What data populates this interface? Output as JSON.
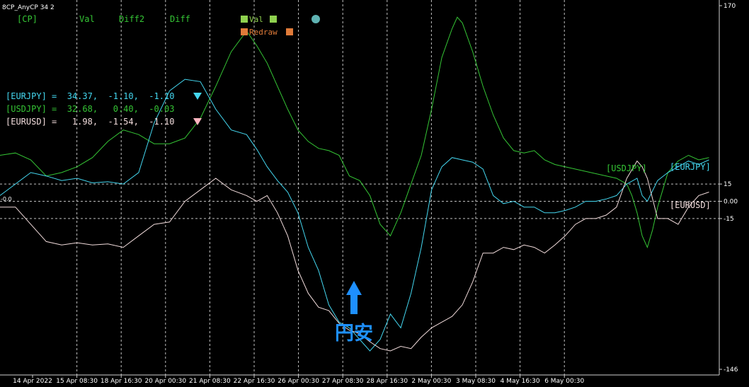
{
  "indicator_title": "8CP_AnyCP 34 2",
  "header_labels": [
    {
      "id": "cp",
      "text": "[CP]",
      "color": "#35c535"
    },
    {
      "id": "val",
      "text": "Val",
      "color": "#35c535"
    },
    {
      "id": "diff2",
      "text": "Diff2",
      "color": "#35c535"
    },
    {
      "id": "diff",
      "text": "Diff",
      "color": "#35c535"
    }
  ],
  "toggles": [
    {
      "id": "val",
      "text": "Val",
      "color": "#8fd14f",
      "box_color": "#8fd14f"
    },
    {
      "id": "redraw",
      "text": "Redraw",
      "color": "#e07b39",
      "box_color": "#e07b39"
    }
  ],
  "dot_color": "#5fb3b3",
  "readouts": [
    {
      "pair": "[EURJPY]",
      "text": "[EURJPY] =  34.37,  -1.10,  -1.10",
      "color": "#44d7f0",
      "marker": "down-triangle",
      "marker_color": "#44d7f0"
    },
    {
      "pair": "[USDJPY]",
      "text": "[USDJPY] =  32.68,   0.40,  -0.03",
      "color": "#35c535"
    },
    {
      "pair": "[EURUSD]",
      "text": "[EURUSD] =   1.98,  -1.54,  -1.10",
      "color": "#f2dcdc",
      "marker": "down-triangle",
      "marker_color": "#ffb6c1"
    }
  ],
  "line_labels": [
    {
      "text": "[USDJPY]",
      "color": "#35c535"
    },
    {
      "text": "[EURJPY]",
      "color": "#44d7f0"
    },
    {
      "text": "[EURUSD]",
      "color": "#f2dcdc"
    }
  ],
  "left_edge_label": "-0.0",
  "annotation": {
    "arrow": "up-arrow",
    "text": "円安",
    "color": "#1e90ff"
  },
  "chart_data": {
    "type": "line",
    "ylim": [
      -146,
      170
    ],
    "y_ticks": [
      "170",
      "15",
      "0.00",
      "-15",
      "-146"
    ],
    "levels": [
      15,
      0,
      -15
    ],
    "x_tick_labels": [
      "14 Apr 2022",
      "15 Apr 08:30",
      "18 Apr 16:30",
      "20 Apr 00:30",
      "21 Apr 08:30",
      "22 Apr 16:30",
      "26 Apr 00:30",
      "27 Apr 08:30",
      "28 Apr 16:30",
      "2 May 00:30",
      "3 May 08:30",
      "4 May 16:30",
      "6 May 00:30"
    ],
    "grid": "vertical dashed at each date label; horizontal dashed at 15, 0, -15",
    "series": [
      {
        "name": "[USDJPY]",
        "color": "#35c535",
        "points": [
          [
            0,
            40
          ],
          [
            3,
            42
          ],
          [
            6,
            36
          ],
          [
            9,
            22
          ],
          [
            12,
            25
          ],
          [
            15,
            30
          ],
          [
            18,
            38
          ],
          [
            21,
            52
          ],
          [
            24,
            62
          ],
          [
            27,
            58
          ],
          [
            30,
            50
          ],
          [
            33,
            50
          ],
          [
            36,
            55
          ],
          [
            39,
            72
          ],
          [
            42,
            100
          ],
          [
            45,
            130
          ],
          [
            48,
            148
          ],
          [
            50,
            135
          ],
          [
            52,
            120
          ],
          [
            54,
            100
          ],
          [
            56,
            80
          ],
          [
            58,
            62
          ],
          [
            60,
            52
          ],
          [
            62,
            46
          ],
          [
            64,
            44
          ],
          [
            66,
            40
          ],
          [
            68,
            22
          ],
          [
            70,
            18
          ],
          [
            72,
            5
          ],
          [
            74,
            -20
          ],
          [
            76,
            -30
          ],
          [
            78,
            -10
          ],
          [
            80,
            15
          ],
          [
            82,
            40
          ],
          [
            84,
            80
          ],
          [
            86,
            125
          ],
          [
            88,
            150
          ],
          [
            89,
            160
          ],
          [
            90,
            155
          ],
          [
            92,
            130
          ],
          [
            94,
            100
          ],
          [
            96,
            75
          ],
          [
            98,
            55
          ],
          [
            100,
            44
          ],
          [
            102,
            42
          ],
          [
            104,
            44
          ],
          [
            106,
            36
          ],
          [
            108,
            32
          ],
          [
            110,
            30
          ],
          [
            112,
            28
          ],
          [
            114,
            26
          ],
          [
            116,
            24
          ],
          [
            118,
            22
          ],
          [
            120,
            20
          ],
          [
            122,
            15
          ],
          [
            123,
            5
          ],
          [
            124,
            -10
          ],
          [
            125,
            -30
          ],
          [
            126,
            -40
          ],
          [
            127,
            -25
          ],
          [
            128,
            -5
          ],
          [
            129,
            10
          ],
          [
            130,
            25
          ],
          [
            132,
            35
          ],
          [
            134,
            40
          ],
          [
            136,
            36
          ],
          [
            138,
            38
          ]
        ]
      },
      {
        "name": "[EURJPY]",
        "color": "#44d7f0",
        "points": [
          [
            0,
            5
          ],
          [
            3,
            15
          ],
          [
            6,
            25
          ],
          [
            9,
            22
          ],
          [
            12,
            18
          ],
          [
            15,
            20
          ],
          [
            18,
            16
          ],
          [
            21,
            17
          ],
          [
            24,
            15
          ],
          [
            27,
            25
          ],
          [
            30,
            68
          ],
          [
            33,
            96
          ],
          [
            36,
            106
          ],
          [
            39,
            104
          ],
          [
            42,
            80
          ],
          [
            45,
            62
          ],
          [
            48,
            58
          ],
          [
            50,
            45
          ],
          [
            52,
            30
          ],
          [
            54,
            18
          ],
          [
            56,
            8
          ],
          [
            58,
            -10
          ],
          [
            60,
            -40
          ],
          [
            62,
            -60
          ],
          [
            64,
            -90
          ],
          [
            66,
            -105
          ],
          [
            68,
            -110
          ],
          [
            70,
            -120
          ],
          [
            72,
            -130
          ],
          [
            74,
            -120
          ],
          [
            76,
            -98
          ],
          [
            78,
            -110
          ],
          [
            80,
            -80
          ],
          [
            82,
            -40
          ],
          [
            84,
            10
          ],
          [
            86,
            30
          ],
          [
            88,
            38
          ],
          [
            90,
            36
          ],
          [
            92,
            34
          ],
          [
            94,
            28
          ],
          [
            96,
            5
          ],
          [
            98,
            -2
          ],
          [
            100,
            0
          ],
          [
            102,
            -5
          ],
          [
            104,
            -5
          ],
          [
            106,
            -10
          ],
          [
            108,
            -10
          ],
          [
            110,
            -8
          ],
          [
            112,
            -5
          ],
          [
            114,
            0
          ],
          [
            116,
            0
          ],
          [
            118,
            2
          ],
          [
            120,
            5
          ],
          [
            122,
            15
          ],
          [
            124,
            20
          ],
          [
            125,
            5
          ],
          [
            126,
            0
          ],
          [
            128,
            18
          ],
          [
            130,
            25
          ],
          [
            132,
            30
          ],
          [
            134,
            35
          ],
          [
            136,
            32
          ],
          [
            138,
            36
          ]
        ]
      },
      {
        "name": "[EURUSD]",
        "color": "#f2dcdc",
        "points": [
          [
            0,
            -5
          ],
          [
            3,
            -5
          ],
          [
            6,
            -20
          ],
          [
            9,
            -35
          ],
          [
            12,
            -38
          ],
          [
            15,
            -36
          ],
          [
            18,
            -38
          ],
          [
            21,
            -37
          ],
          [
            24,
            -40
          ],
          [
            27,
            -30
          ],
          [
            30,
            -20
          ],
          [
            33,
            -18
          ],
          [
            36,
            0
          ],
          [
            39,
            10
          ],
          [
            42,
            20
          ],
          [
            45,
            10
          ],
          [
            48,
            5
          ],
          [
            50,
            0
          ],
          [
            52,
            5
          ],
          [
            54,
            -10
          ],
          [
            56,
            -30
          ],
          [
            58,
            -60
          ],
          [
            60,
            -80
          ],
          [
            62,
            -92
          ],
          [
            64,
            -95
          ],
          [
            66,
            -106
          ],
          [
            68,
            -112
          ],
          [
            70,
            -115
          ],
          [
            72,
            -122
          ],
          [
            74,
            -128
          ],
          [
            76,
            -130
          ],
          [
            78,
            -126
          ],
          [
            80,
            -128
          ],
          [
            82,
            -118
          ],
          [
            84,
            -110
          ],
          [
            86,
            -105
          ],
          [
            88,
            -100
          ],
          [
            90,
            -90
          ],
          [
            92,
            -70
          ],
          [
            94,
            -45
          ],
          [
            96,
            -45
          ],
          [
            98,
            -40
          ],
          [
            100,
            -42
          ],
          [
            102,
            -38
          ],
          [
            104,
            -40
          ],
          [
            106,
            -45
          ],
          [
            108,
            -38
          ],
          [
            110,
            -30
          ],
          [
            112,
            -20
          ],
          [
            114,
            -15
          ],
          [
            116,
            -15
          ],
          [
            118,
            -12
          ],
          [
            120,
            -5
          ],
          [
            122,
            20
          ],
          [
            124,
            35
          ],
          [
            125,
            30
          ],
          [
            126,
            20
          ],
          [
            128,
            -15
          ],
          [
            130,
            -15
          ],
          [
            132,
            -20
          ],
          [
            134,
            -5
          ],
          [
            136,
            5
          ],
          [
            138,
            8
          ]
        ]
      }
    ]
  }
}
